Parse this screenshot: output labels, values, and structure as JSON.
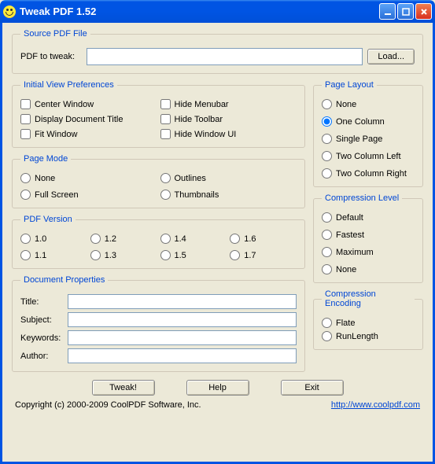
{
  "window": {
    "title": "Tweak PDF 1.52"
  },
  "source": {
    "legend": "Source PDF File",
    "label": "PDF to tweak:",
    "value": "",
    "load": "Load..."
  },
  "ivp": {
    "legend": "Initial View Preferences",
    "center": "Center Window",
    "displayTitle": "Display Document Title",
    "fit": "Fit Window",
    "hideMenu": "Hide Menubar",
    "hideToolbar": "Hide Toolbar",
    "hideUI": "Hide Window UI"
  },
  "pageMode": {
    "legend": "Page Mode",
    "none": "None",
    "fullscreen": "Full Screen",
    "outlines": "Outlines",
    "thumbnails": "Thumbnails"
  },
  "pdfVersion": {
    "legend": "PDF Version",
    "v10": "1.0",
    "v11": "1.1",
    "v12": "1.2",
    "v13": "1.3",
    "v14": "1.4",
    "v15": "1.5",
    "v16": "1.6",
    "v17": "1.7"
  },
  "docProps": {
    "legend": "Document Properties",
    "title": "Title:",
    "subject": "Subject:",
    "keywords": "Keywords:",
    "author": "Author:",
    "titleVal": "",
    "subjectVal": "",
    "keywordsVal": "",
    "authorVal": ""
  },
  "pageLayout": {
    "legend": "Page Layout",
    "none": "None",
    "oneCol": "One Column",
    "single": "Single Page",
    "twoLeft": "Two Column Left",
    "twoRight": "Two Column Right"
  },
  "compLevel": {
    "legend": "Compression Level",
    "default": "Default",
    "fastest": "Fastest",
    "max": "Maximum",
    "none": "None"
  },
  "compEnc": {
    "legend": "Compression Encoding",
    "flate": "Flate",
    "runlength": "RunLength"
  },
  "actions": {
    "tweak": "Tweak!",
    "help": "Help",
    "exit": "Exit"
  },
  "footer": {
    "copyright": "Copyright (c) 2000-2009 CoolPDF Software, Inc.",
    "url": "http://www.coolpdf.com"
  }
}
